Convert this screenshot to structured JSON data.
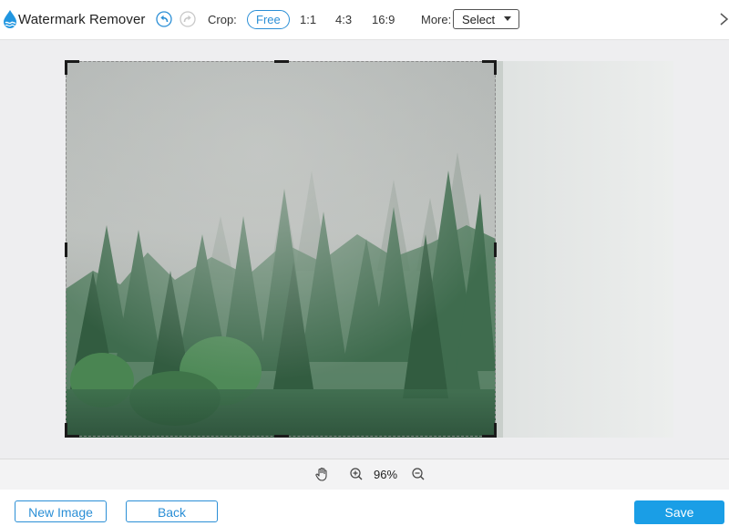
{
  "app": {
    "title": "Watermark Remover"
  },
  "toolbar": {
    "undo_icon": "undo-icon",
    "redo_icon": "redo-icon",
    "crop_label": "Crop:",
    "crop_options": [
      "Free",
      "1:1",
      "4:3",
      "16:9"
    ],
    "crop_active": "Free",
    "more_label": "More:",
    "select_value": "Select",
    "close_icon": "chevron-right-icon"
  },
  "zoom": {
    "pan_icon": "hand-icon",
    "zoom_in_icon": "zoom-in-icon",
    "zoom_out_icon": "zoom-out-icon",
    "value": "96%"
  },
  "buttons": {
    "new_image": "New Image",
    "back": "Back",
    "save": "Save"
  },
  "colors": {
    "accent": "#2b8fd6",
    "save_bg": "#1a9ee6",
    "canvas_bg": "#eeeef0"
  }
}
